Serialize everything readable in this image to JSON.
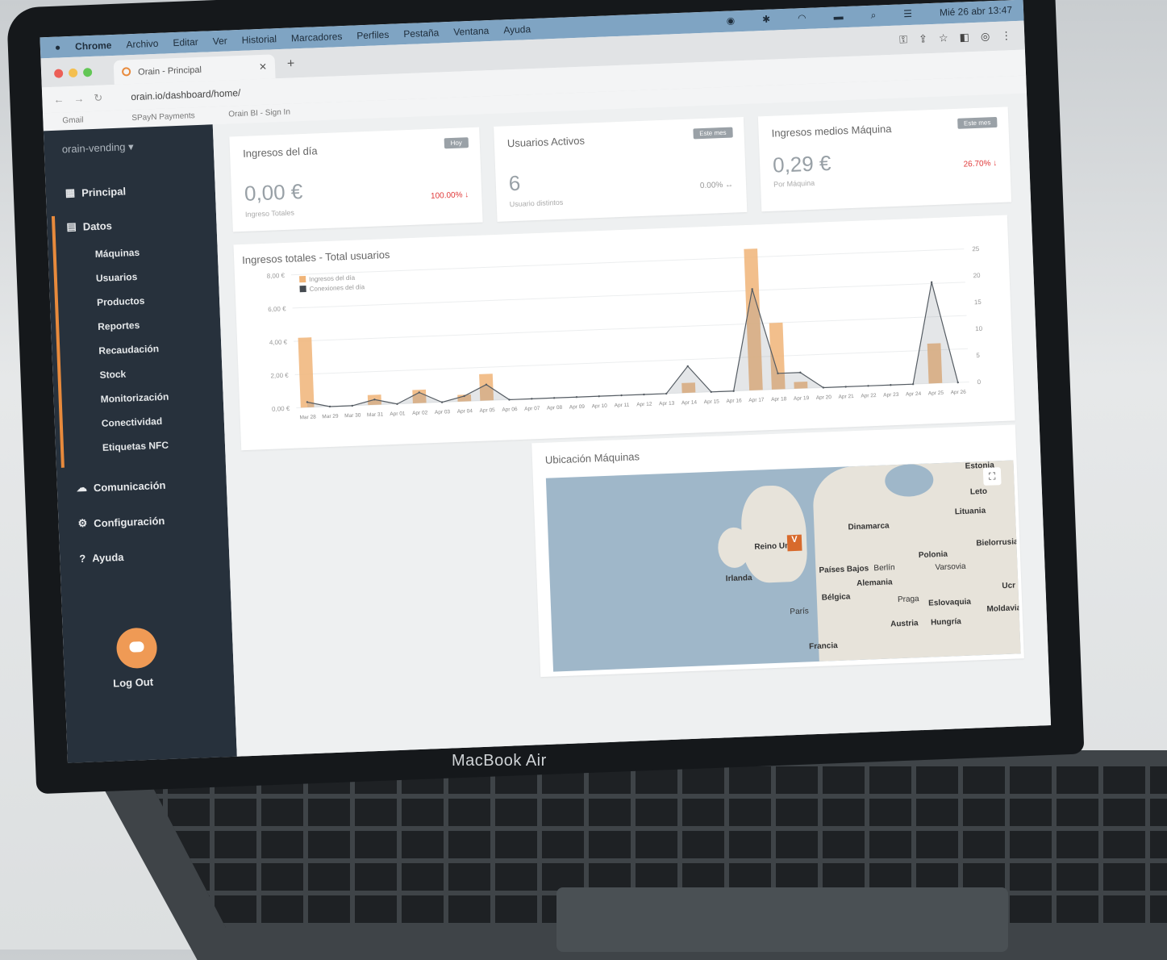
{
  "menubar": {
    "apple": "",
    "app": "Chrome",
    "items": [
      "Archivo",
      "Editar",
      "Ver",
      "Historial",
      "Marcadores",
      "Perfiles",
      "Pestaña",
      "Ventana",
      "Ayuda"
    ],
    "clock": "Mié 26 abr 13:47"
  },
  "browser": {
    "tab_title": "Orain - Principal",
    "url": "orain.io/dashboard/home/",
    "bookmarks": [
      "Gmail",
      "SPayN Payments",
      "Orain BI - Sign In"
    ]
  },
  "sidebar": {
    "account": "orain-vending ▾",
    "principal": "Principal",
    "datos": "Datos",
    "sub": [
      "Máquinas",
      "Usuarios",
      "Productos",
      "Reportes",
      "Recaudación",
      "Stock",
      "Monitorización",
      "Conectividad",
      "Etiquetas NFC"
    ],
    "comunicacion": "Comunicación",
    "configuracion": "Configuración",
    "ayuda": "Ayuda",
    "logout": "Log Out"
  },
  "cards": [
    {
      "title": "Ingresos del día",
      "badge": "Hoy",
      "value": "0,00 €",
      "sub": "Ingreso Totales",
      "pct": "100.00% ↓"
    },
    {
      "title": "Usuarios Activos",
      "badge": "Este mes",
      "value": "6",
      "sub": "Usuario distintos",
      "pct": "0.00% ↔"
    },
    {
      "title": "Ingresos medios Máquina",
      "badge": "Este mes",
      "value": "0,29 €",
      "sub": "Por Máquina",
      "pct": "26.70% ↓"
    }
  ],
  "colors": {
    "accent": "#e88a3c",
    "negative": "#e03a3a",
    "neutral": "#999999"
  },
  "chart_data": {
    "type": "bar",
    "title": "Ingresos totales - Total usuarios",
    "categories": [
      "Mar 28",
      "Mar 29",
      "Mar 30",
      "Mar 31",
      "Apr 01",
      "Apr 02",
      "Apr 03",
      "Apr 04",
      "Apr 05",
      "Apr 06",
      "Apr 07",
      "Apr 08",
      "Apr 09",
      "Apr 10",
      "Apr 11",
      "Apr 12",
      "Apr 13",
      "Apr 14",
      "Apr 15",
      "Apr 16",
      "Apr 17",
      "Apr 18",
      "Apr 19",
      "Apr 20",
      "Apr 21",
      "Apr 22",
      "Apr 23",
      "Apr 24",
      "Apr 25",
      "Apr 26"
    ],
    "series": [
      {
        "name": "Ingresos del día",
        "axis": "left",
        "values": [
          4.2,
          0,
          0,
          0.6,
          0,
          0.8,
          0,
          0.4,
          1.6,
          0,
          0,
          0,
          0,
          0,
          0,
          0,
          0,
          0.6,
          0,
          0,
          8.5,
          4.0,
          0.4,
          0,
          0,
          0,
          0,
          0,
          2.4,
          0
        ]
      },
      {
        "name": "Conexiones del día",
        "axis": "right",
        "values": [
          1,
          0,
          0,
          1,
          0,
          2,
          0,
          1,
          3,
          0,
          0,
          0,
          0,
          0,
          0,
          0,
          0,
          5,
          0,
          0,
          19,
          3,
          3,
          0,
          0,
          0,
          0,
          0,
          19,
          0
        ]
      }
    ],
    "y_left": {
      "ticks": [
        "0,00 €",
        "2,00 €",
        "4,00 €",
        "6,00 €",
        "8,00 €"
      ],
      "ylim": [
        0,
        8
      ]
    },
    "y_right": {
      "ticks": [
        "0",
        "5",
        "10",
        "15",
        "20",
        "25"
      ],
      "ylim": [
        0,
        25
      ]
    },
    "x_tick_labels": [
      "Mar 28",
      "Mar 29",
      "Mar 30",
      "Mar 31",
      "Apr 01",
      "Apr 02",
      "Apr 03",
      "Apr 04",
      "Apr 05",
      "Apr 06",
      "Apr 07",
      "Apr 08",
      "Apr 09",
      "Apr 10",
      "Apr 11",
      "Apr 12",
      "Apr 13",
      "Apr 14",
      "Apr 15",
      "Apr 16",
      "Apr 17",
      "Apr 18",
      "Apr 19",
      "Apr 20",
      "Apr 21",
      "Apr 22",
      "Apr 23",
      "Apr 24",
      "Apr 25",
      "Apr 26"
    ],
    "legend_position": "top-left"
  },
  "map": {
    "title": "Ubicación Máquinas",
    "labels": [
      "Estonia",
      "Leto",
      "Lituania",
      "Dinamarca",
      "Reino Unido",
      "Irlanda",
      "Países Bajos",
      "Berlín",
      "Polonia",
      "Varsovia",
      "Bielorrusia",
      "Alemania",
      "Bélgica",
      "París",
      "Praga",
      "Eslovaquia",
      "Austria",
      "Hungría",
      "Francia",
      "Moldavia",
      "Ucr"
    ],
    "pin": "V"
  },
  "laptop": {
    "brand": "MacBook Air"
  }
}
